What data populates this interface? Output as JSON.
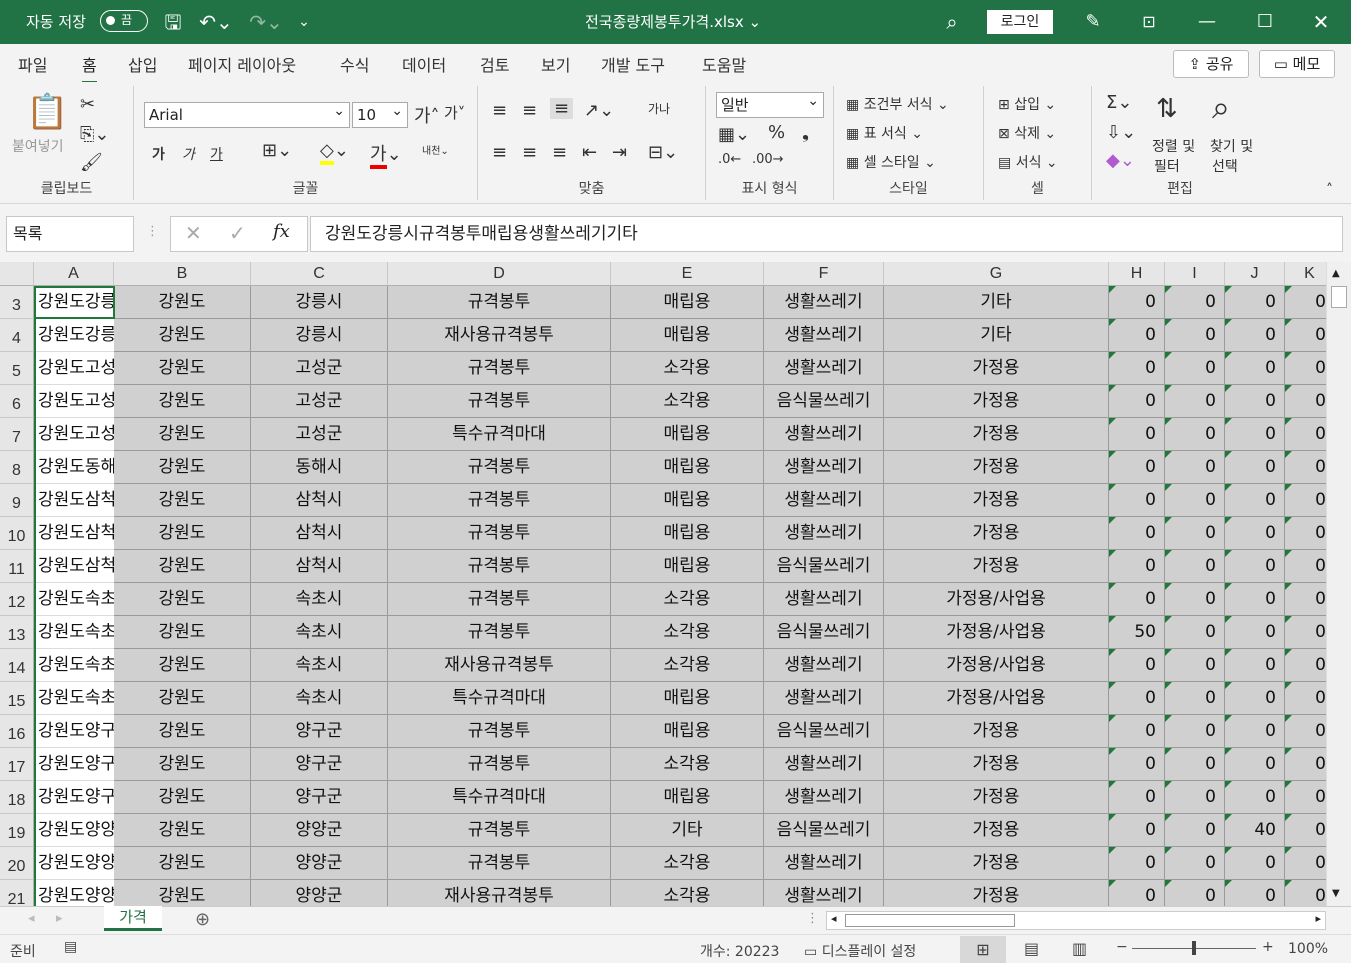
{
  "titlebar": {
    "autosave": "자동 저장",
    "toggle": "끔",
    "filename": "전국종량제봉투가격.xlsx",
    "login": "로그인"
  },
  "menu": {
    "tabs": [
      "파일",
      "홈",
      "삽입",
      "페이지 레이아웃",
      "수식",
      "데이터",
      "검토",
      "보기",
      "개발 도구",
      "도움말"
    ],
    "active": "홈",
    "share": "공유",
    "memo": "메모"
  },
  "ribbon": {
    "clipboard": {
      "paste": "붙여넣기",
      "label": "클립보드"
    },
    "font": {
      "name": "Arial",
      "size": "10",
      "bold": "가",
      "italic": "가",
      "underline": "가",
      "label": "글꼴"
    },
    "align": {
      "label": "맞춤",
      "wrap": "내천"
    },
    "number": {
      "format": "일반",
      "label": "표시 형식"
    },
    "styles": {
      "cond": "조건부 서식",
      "table": "표 서식",
      "cell": "셀 스타일",
      "label": "스타일"
    },
    "cells": {
      "insert": "삽입",
      "delete": "삭제",
      "format": "서식",
      "label": "셀"
    },
    "edit": {
      "sort": "정렬 및",
      "sort2": "필터",
      "find": "찾기 및",
      "find2": "선택",
      "label": "편집"
    }
  },
  "formula": {
    "namebox": "목록",
    "value": "강원도강릉시규격봉투매립용생활쓰레기기타"
  },
  "columns": [
    "A",
    "B",
    "C",
    "D",
    "E",
    "F",
    "G",
    "H",
    "I",
    "J",
    "K"
  ],
  "rows": [
    {
      "r": "3",
      "a": "강원도강릉",
      "b": "강원도",
      "c": "강릉시",
      "d": "규격봉투",
      "e": "매립용",
      "f": "생활쓰레기",
      "g": "기타",
      "h": "0",
      "i": "0",
      "j": "0",
      "k": "0"
    },
    {
      "r": "4",
      "a": "강원도강릉",
      "b": "강원도",
      "c": "강릉시",
      "d": "재사용규격봉투",
      "e": "매립용",
      "f": "생활쓰레기",
      "g": "기타",
      "h": "0",
      "i": "0",
      "j": "0",
      "k": "0"
    },
    {
      "r": "5",
      "a": "강원도고성",
      "b": "강원도",
      "c": "고성군",
      "d": "규격봉투",
      "e": "소각용",
      "f": "생활쓰레기",
      "g": "가정용",
      "h": "0",
      "i": "0",
      "j": "0",
      "k": "0"
    },
    {
      "r": "6",
      "a": "강원도고성",
      "b": "강원도",
      "c": "고성군",
      "d": "규격봉투",
      "e": "소각용",
      "f": "음식물쓰레기",
      "g": "가정용",
      "h": "0",
      "i": "0",
      "j": "0",
      "k": "0"
    },
    {
      "r": "7",
      "a": "강원도고성",
      "b": "강원도",
      "c": "고성군",
      "d": "특수규격마대",
      "e": "매립용",
      "f": "생활쓰레기",
      "g": "가정용",
      "h": "0",
      "i": "0",
      "j": "0",
      "k": "0"
    },
    {
      "r": "8",
      "a": "강원도동해",
      "b": "강원도",
      "c": "동해시",
      "d": "규격봉투",
      "e": "매립용",
      "f": "생활쓰레기",
      "g": "가정용",
      "h": "0",
      "i": "0",
      "j": "0",
      "k": "0"
    },
    {
      "r": "9",
      "a": "강원도삼척",
      "b": "강원도",
      "c": "삼척시",
      "d": "규격봉투",
      "e": "매립용",
      "f": "생활쓰레기",
      "g": "가정용",
      "h": "0",
      "i": "0",
      "j": "0",
      "k": "0"
    },
    {
      "r": "10",
      "a": "강원도삼척",
      "b": "강원도",
      "c": "삼척시",
      "d": "규격봉투",
      "e": "매립용",
      "f": "생활쓰레기",
      "g": "가정용",
      "h": "0",
      "i": "0",
      "j": "0",
      "k": "0"
    },
    {
      "r": "11",
      "a": "강원도삼척",
      "b": "강원도",
      "c": "삼척시",
      "d": "규격봉투",
      "e": "매립용",
      "f": "음식물쓰레기",
      "g": "가정용",
      "h": "0",
      "i": "0",
      "j": "0",
      "k": "0"
    },
    {
      "r": "12",
      "a": "강원도속초",
      "b": "강원도",
      "c": "속초시",
      "d": "규격봉투",
      "e": "소각용",
      "f": "생활쓰레기",
      "g": "가정용/사업용",
      "h": "0",
      "i": "0",
      "j": "0",
      "k": "0"
    },
    {
      "r": "13",
      "a": "강원도속초",
      "b": "강원도",
      "c": "속초시",
      "d": "규격봉투",
      "e": "소각용",
      "f": "음식물쓰레기",
      "g": "가정용/사업용",
      "h": "50",
      "i": "0",
      "j": "0",
      "k": "0"
    },
    {
      "r": "14",
      "a": "강원도속초",
      "b": "강원도",
      "c": "속초시",
      "d": "재사용규격봉투",
      "e": "소각용",
      "f": "생활쓰레기",
      "g": "가정용/사업용",
      "h": "0",
      "i": "0",
      "j": "0",
      "k": "0"
    },
    {
      "r": "15",
      "a": "강원도속초",
      "b": "강원도",
      "c": "속초시",
      "d": "특수규격마대",
      "e": "매립용",
      "f": "생활쓰레기",
      "g": "가정용/사업용",
      "h": "0",
      "i": "0",
      "j": "0",
      "k": "0"
    },
    {
      "r": "16",
      "a": "강원도양구",
      "b": "강원도",
      "c": "양구군",
      "d": "규격봉투",
      "e": "매립용",
      "f": "음식물쓰레기",
      "g": "가정용",
      "h": "0",
      "i": "0",
      "j": "0",
      "k": "0"
    },
    {
      "r": "17",
      "a": "강원도양구",
      "b": "강원도",
      "c": "양구군",
      "d": "규격봉투",
      "e": "소각용",
      "f": "생활쓰레기",
      "g": "가정용",
      "h": "0",
      "i": "0",
      "j": "0",
      "k": "0"
    },
    {
      "r": "18",
      "a": "강원도양구",
      "b": "강원도",
      "c": "양구군",
      "d": "특수규격마대",
      "e": "매립용",
      "f": "생활쓰레기",
      "g": "가정용",
      "h": "0",
      "i": "0",
      "j": "0",
      "k": "0"
    },
    {
      "r": "19",
      "a": "강원도양양",
      "b": "강원도",
      "c": "양양군",
      "d": "규격봉투",
      "e": "기타",
      "f": "음식물쓰레기",
      "g": "가정용",
      "h": "0",
      "i": "0",
      "j": "40",
      "k": "0"
    },
    {
      "r": "20",
      "a": "강원도양양",
      "b": "강원도",
      "c": "양양군",
      "d": "규격봉투",
      "e": "소각용",
      "f": "생활쓰레기",
      "g": "가정용",
      "h": "0",
      "i": "0",
      "j": "0",
      "k": "0"
    },
    {
      "r": "21",
      "a": "강원도양양",
      "b": "강원도",
      "c": "양양군",
      "d": "재사용규격봉투",
      "e": "소각용",
      "f": "생활쓰레기",
      "g": "가정용",
      "h": "0",
      "i": "0",
      "j": "0",
      "k": "0"
    }
  ],
  "sheet": {
    "tab": "가격"
  },
  "status": {
    "ready": "준비",
    "count": "개수: 20223",
    "display": "디스플레이 설정",
    "zoom": "100%"
  }
}
